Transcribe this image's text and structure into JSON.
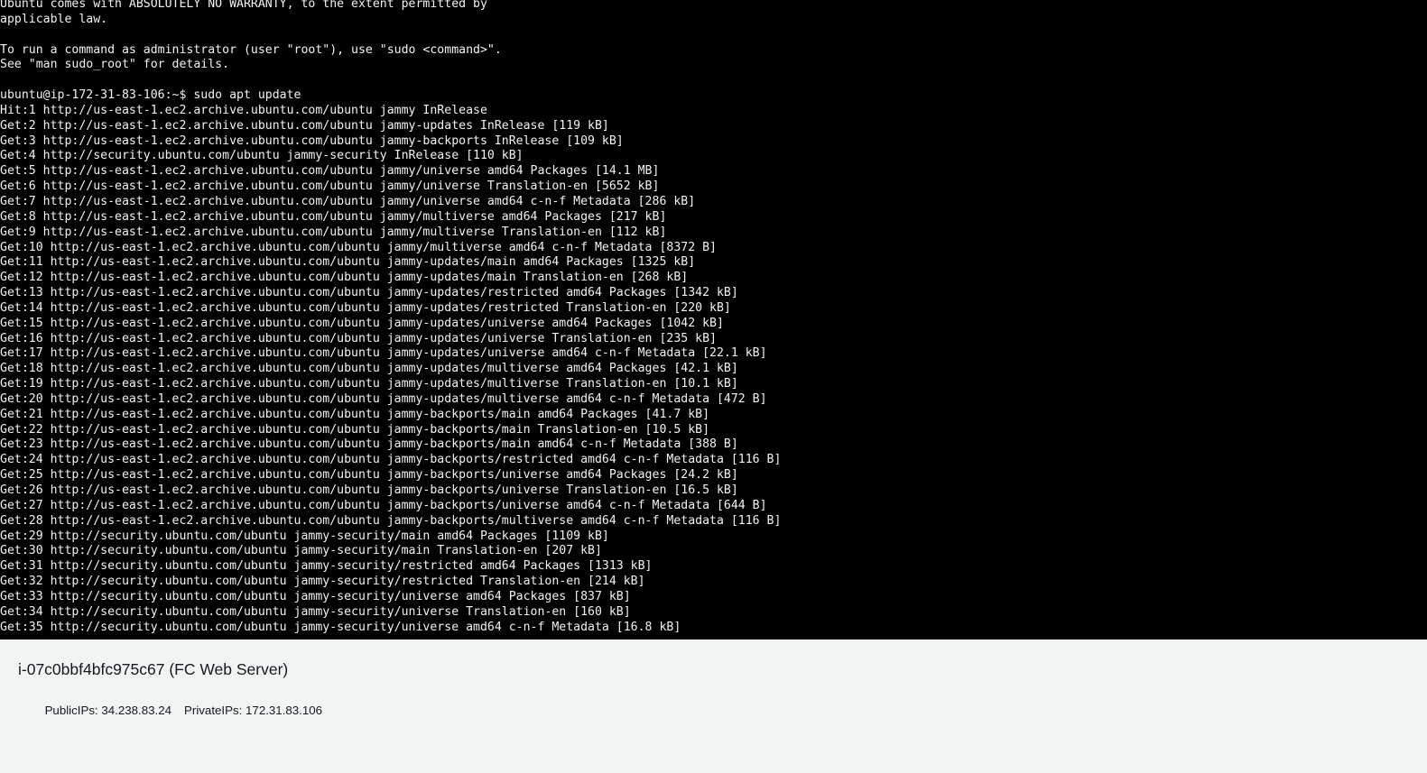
{
  "terminal": {
    "prompt_user_host": "ubuntu@ip-172-31-83-106",
    "lines": [
      "Ubuntu comes with ABSOLUTELY NO WARRANTY, to the extent permitted by",
      "applicable law.",
      "",
      "To run a command as administrator (user \"root\"), use \"sudo <command>\".",
      "See \"man sudo_root\" for details.",
      "",
      "ubuntu@ip-172-31-83-106:~$ sudo apt update",
      "Hit:1 http://us-east-1.ec2.archive.ubuntu.com/ubuntu jammy InRelease",
      "Get:2 http://us-east-1.ec2.archive.ubuntu.com/ubuntu jammy-updates InRelease [119 kB]",
      "Get:3 http://us-east-1.ec2.archive.ubuntu.com/ubuntu jammy-backports InRelease [109 kB]",
      "Get:4 http://security.ubuntu.com/ubuntu jammy-security InRelease [110 kB]",
      "Get:5 http://us-east-1.ec2.archive.ubuntu.com/ubuntu jammy/universe amd64 Packages [14.1 MB]",
      "Get:6 http://us-east-1.ec2.archive.ubuntu.com/ubuntu jammy/universe Translation-en [5652 kB]",
      "Get:7 http://us-east-1.ec2.archive.ubuntu.com/ubuntu jammy/universe amd64 c-n-f Metadata [286 kB]",
      "Get:8 http://us-east-1.ec2.archive.ubuntu.com/ubuntu jammy/multiverse amd64 Packages [217 kB]",
      "Get:9 http://us-east-1.ec2.archive.ubuntu.com/ubuntu jammy/multiverse Translation-en [112 kB]",
      "Get:10 http://us-east-1.ec2.archive.ubuntu.com/ubuntu jammy/multiverse amd64 c-n-f Metadata [8372 B]",
      "Get:11 http://us-east-1.ec2.archive.ubuntu.com/ubuntu jammy-updates/main amd64 Packages [1325 kB]",
      "Get:12 http://us-east-1.ec2.archive.ubuntu.com/ubuntu jammy-updates/main Translation-en [268 kB]",
      "Get:13 http://us-east-1.ec2.archive.ubuntu.com/ubuntu jammy-updates/restricted amd64 Packages [1342 kB]",
      "Get:14 http://us-east-1.ec2.archive.ubuntu.com/ubuntu jammy-updates/restricted Translation-en [220 kB]",
      "Get:15 http://us-east-1.ec2.archive.ubuntu.com/ubuntu jammy-updates/universe amd64 Packages [1042 kB]",
      "Get:16 http://us-east-1.ec2.archive.ubuntu.com/ubuntu jammy-updates/universe Translation-en [235 kB]",
      "Get:17 http://us-east-1.ec2.archive.ubuntu.com/ubuntu jammy-updates/universe amd64 c-n-f Metadata [22.1 kB]",
      "Get:18 http://us-east-1.ec2.archive.ubuntu.com/ubuntu jammy-updates/multiverse amd64 Packages [42.1 kB]",
      "Get:19 http://us-east-1.ec2.archive.ubuntu.com/ubuntu jammy-updates/multiverse Translation-en [10.1 kB]",
      "Get:20 http://us-east-1.ec2.archive.ubuntu.com/ubuntu jammy-updates/multiverse amd64 c-n-f Metadata [472 B]",
      "Get:21 http://us-east-1.ec2.archive.ubuntu.com/ubuntu jammy-backports/main amd64 Packages [41.7 kB]",
      "Get:22 http://us-east-1.ec2.archive.ubuntu.com/ubuntu jammy-backports/main Translation-en [10.5 kB]",
      "Get:23 http://us-east-1.ec2.archive.ubuntu.com/ubuntu jammy-backports/main amd64 c-n-f Metadata [388 B]",
      "Get:24 http://us-east-1.ec2.archive.ubuntu.com/ubuntu jammy-backports/restricted amd64 c-n-f Metadata [116 B]",
      "Get:25 http://us-east-1.ec2.archive.ubuntu.com/ubuntu jammy-backports/universe amd64 Packages [24.2 kB]",
      "Get:26 http://us-east-1.ec2.archive.ubuntu.com/ubuntu jammy-backports/universe Translation-en [16.5 kB]",
      "Get:27 http://us-east-1.ec2.archive.ubuntu.com/ubuntu jammy-backports/universe amd64 c-n-f Metadata [644 B]",
      "Get:28 http://us-east-1.ec2.archive.ubuntu.com/ubuntu jammy-backports/multiverse amd64 c-n-f Metadata [116 B]",
      "Get:29 http://security.ubuntu.com/ubuntu jammy-security/main amd64 Packages [1109 kB]",
      "Get:30 http://security.ubuntu.com/ubuntu jammy-security/main Translation-en [207 kB]",
      "Get:31 http://security.ubuntu.com/ubuntu jammy-security/restricted amd64 Packages [1313 kB]",
      "Get:32 http://security.ubuntu.com/ubuntu jammy-security/restricted Translation-en [214 kB]",
      "Get:33 http://security.ubuntu.com/ubuntu jammy-security/universe amd64 Packages [837 kB]",
      "Get:34 http://security.ubuntu.com/ubuntu jammy-security/universe Translation-en [160 kB]",
      "Get:35 http://security.ubuntu.com/ubuntu jammy-security/universe amd64 c-n-f Metadata [16.8 kB]"
    ]
  },
  "footer": {
    "instance_title": "i-07c0bbf4bfc975c67 (FC Web Server)",
    "public_ips_label": "PublicIPs:",
    "public_ips_value": "34.238.83.24",
    "private_ips_label": "PrivateIPs:",
    "private_ips_value": "172.31.83.106"
  },
  "colors": {
    "terminal_bg": "#000000",
    "terminal_fg": "#f2f2f2",
    "footer_bg": "#f2f3f3",
    "footer_fg": "#16191f"
  }
}
